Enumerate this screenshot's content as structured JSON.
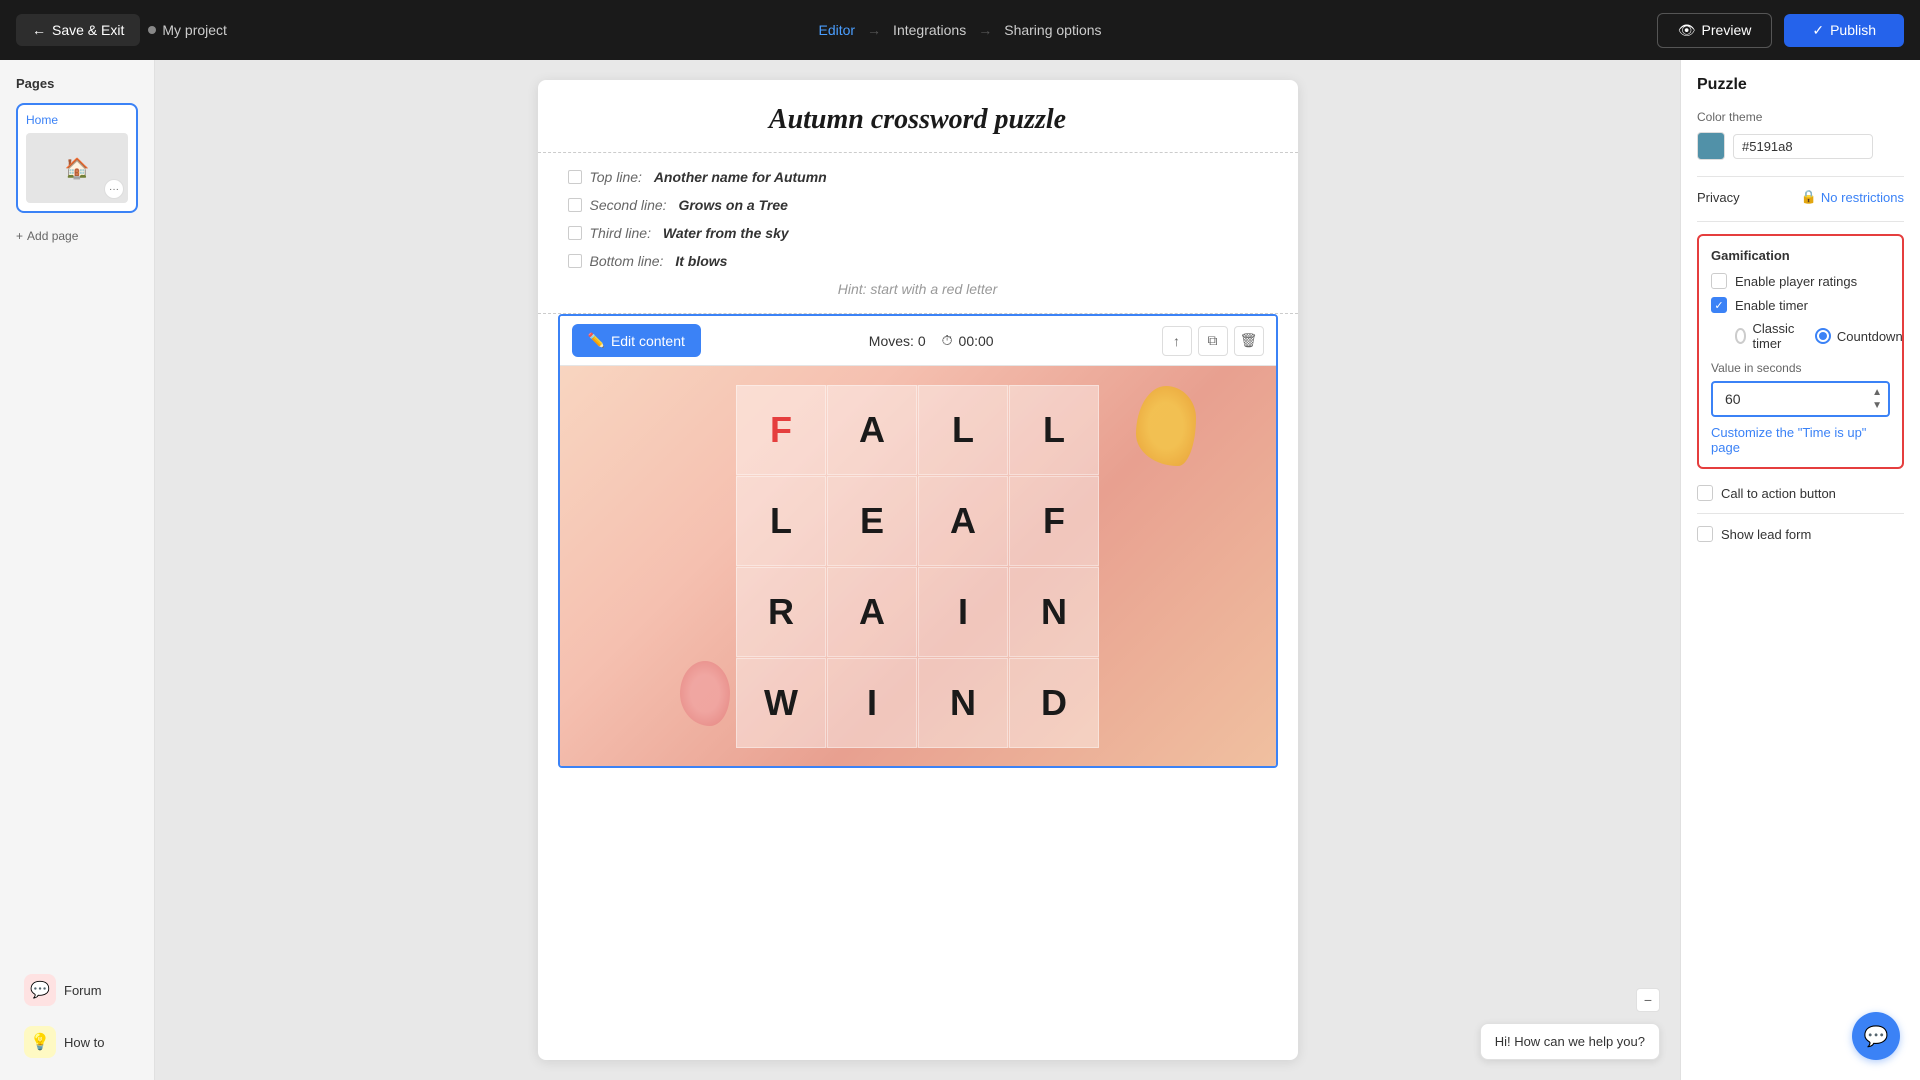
{
  "nav": {
    "save_exit_label": "Save & Exit",
    "project_name": "My project",
    "editor_label": "Editor",
    "integrations_label": "Integrations",
    "sharing_label": "Sharing options",
    "preview_label": "Preview",
    "publish_label": "Publish"
  },
  "sidebar": {
    "title": "Pages",
    "home_page_label": "Home",
    "add_page_label": "Add page",
    "bottom_items": [
      {
        "id": "forum",
        "label": "Forum",
        "icon": "💬"
      },
      {
        "id": "howto",
        "label": "How to",
        "icon": "💡"
      }
    ]
  },
  "canvas": {
    "puzzle_title": "Autumn crossword puzzle",
    "clues": [
      {
        "prefix": "Top line:",
        "bold": "Another name for Autumn"
      },
      {
        "prefix": "Second line:",
        "bold": "Grows on a Tree"
      },
      {
        "prefix": "Third line:",
        "bold": "Water from the sky"
      },
      {
        "prefix": "Bottom line:",
        "bold": "It blows"
      }
    ],
    "hint": "Hint: start with a red letter",
    "edit_content_label": "Edit content",
    "moves_label": "Moves:",
    "moves_value": "0",
    "timer_value": "00:00",
    "grid": [
      [
        "F",
        "A",
        "L",
        "L"
      ],
      [
        "L",
        "E",
        "A",
        "F"
      ],
      [
        "R",
        "A",
        "I",
        "N"
      ],
      [
        "W",
        "I",
        "N",
        "D"
      ]
    ],
    "red_letter": "F"
  },
  "right_panel": {
    "title": "Puzzle",
    "color_theme_label": "Color theme",
    "color_value": "#5191a8",
    "privacy_label": "Privacy",
    "privacy_value": "No restrictions",
    "gamification": {
      "title": "Gamification",
      "enable_ratings_label": "Enable player ratings",
      "enable_timer_label": "Enable timer",
      "timer_options": [
        "Classic timer",
        "Countdown"
      ],
      "selected_timer": "Countdown",
      "value_label": "Value in seconds",
      "value": "60",
      "customize_link": "Customize the \"Time is up\" page"
    },
    "cta_label": "Call to action button",
    "lead_form_label": "Show lead form",
    "help_text": "Hi! How can we help you?"
  }
}
